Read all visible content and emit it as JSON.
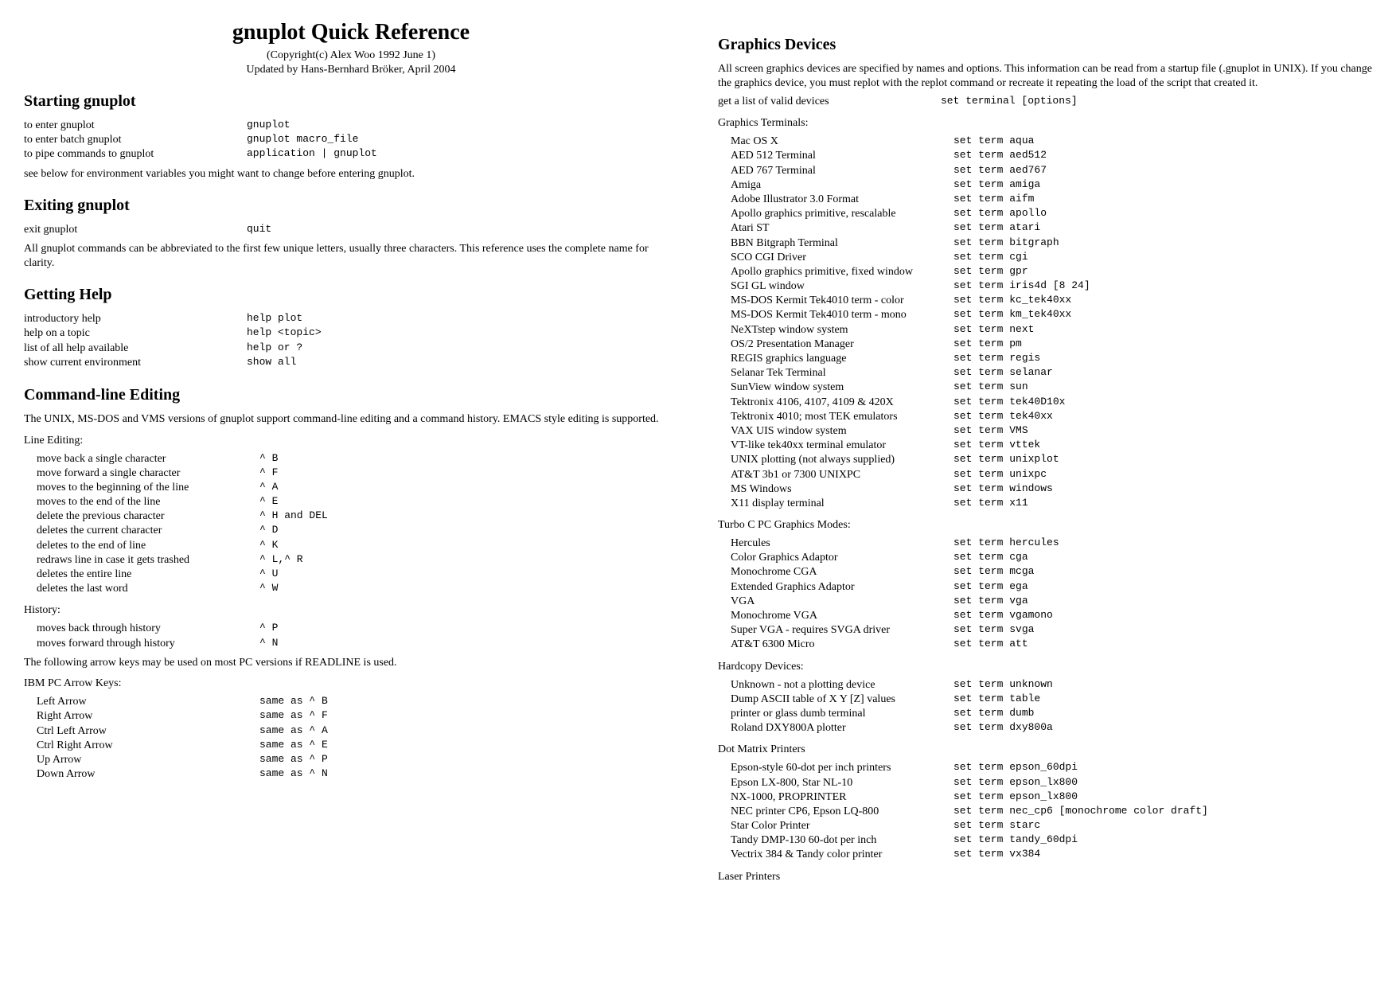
{
  "title": "gnuplot Quick Reference",
  "copyright": "(Copyright(c) Alex Woo 1992 June 1)",
  "updated": "Updated by Hans-Bernhard Bröker, April 2004",
  "sections": {
    "starting": {
      "heading": "Starting gnuplot",
      "rows": [
        {
          "label": "to enter gnuplot",
          "cmd": "gnuplot"
        },
        {
          "label": "to enter batch gnuplot",
          "cmd": "gnuplot macro_file"
        },
        {
          "label": "to pipe commands to gnuplot",
          "cmd": "application | gnuplot"
        }
      ],
      "note": "see below for environment variables you might want to change before entering gnuplot."
    },
    "exiting": {
      "heading": "Exiting gnuplot",
      "rows": [
        {
          "label": "exit gnuplot",
          "cmd": "quit"
        }
      ],
      "note": "All gnuplot commands can be abbreviated to the first few unique letters, usually three characters. This reference uses the complete name for clarity."
    },
    "help": {
      "heading": "Getting Help",
      "rows": [
        {
          "label": "introductory help",
          "cmd": "help plot"
        },
        {
          "label": "help on a topic",
          "cmd": "help <topic>"
        },
        {
          "label": "list of all help available",
          "cmd": "help or ?"
        },
        {
          "label": "show current environment",
          "cmd": "show all"
        }
      ]
    },
    "cmdline": {
      "heading": "Command-line Editing",
      "intro": "The UNIX, MS-DOS and VMS versions of gnuplot support command-line editing and a command history. EMACS style editing is supported.",
      "lineEditingLabel": "Line Editing:",
      "lineEditing": [
        {
          "label": "move back a single character",
          "cmd": "^ B"
        },
        {
          "label": "move forward a single character",
          "cmd": "^ F"
        },
        {
          "label": "moves to the beginning of the line",
          "cmd": "^ A"
        },
        {
          "label": "moves to the end of the line",
          "cmd": "^ E"
        },
        {
          "label": "delete the previous character",
          "cmd": "^ H and DEL"
        },
        {
          "label": "deletes the current character",
          "cmd": "^ D"
        },
        {
          "label": "deletes to the end of line",
          "cmd": "^ K"
        },
        {
          "label": "redraws line in case it gets trashed",
          "cmd": "^ L,^ R"
        },
        {
          "label": "deletes the entire line",
          "cmd": "^ U"
        },
        {
          "label": "deletes the last word",
          "cmd": "^ W"
        }
      ],
      "historyLabel": "History:",
      "history": [
        {
          "label": "moves back through history",
          "cmd": "^ P"
        },
        {
          "label": "moves forward through history",
          "cmd": "^ N"
        }
      ],
      "arrowNote": "The following arrow keys may be used on most PC versions if READLINE is used.",
      "arrowKeysLabel": "IBM PC Arrow Keys:",
      "arrowKeys": [
        {
          "label": "Left Arrow",
          "cmd": "same as ^ B"
        },
        {
          "label": "Right Arrow",
          "cmd": "same as ^ F"
        },
        {
          "label": "Ctrl Left Arrow",
          "cmd": "same as ^ A"
        },
        {
          "label": "Ctrl Right Arrow",
          "cmd": "same as ^ E"
        },
        {
          "label": "Up Arrow",
          "cmd": "same as ^ P"
        },
        {
          "label": "Down Arrow",
          "cmd": "same as ^ N"
        }
      ]
    },
    "graphics": {
      "heading": "Graphics Devices",
      "intro": "All screen graphics devices are specified by names and options. This information can be read from a startup file (.gnuplot in UNIX). If you change the graphics device, you must replot with the replot command or recreate it repeating the load of the script that created it.",
      "listRow": {
        "label": "get a list of valid devices",
        "cmd": "set terminal [options]"
      },
      "termLabel": "Graphics Terminals:",
      "terminals": [
        {
          "label": "Mac OS X",
          "cmd": "set term aqua"
        },
        {
          "label": "AED 512 Terminal",
          "cmd": "set term aed512"
        },
        {
          "label": "AED 767 Terminal",
          "cmd": "set term aed767"
        },
        {
          "label": "Amiga",
          "cmd": "set term amiga"
        },
        {
          "label": "Adobe Illustrator 3.0 Format",
          "cmd": "set term aifm"
        },
        {
          "label": "Apollo graphics primitive, rescalable",
          "cmd": "set term apollo"
        },
        {
          "label": "Atari ST",
          "cmd": "set term atari"
        },
        {
          "label": "BBN Bitgraph Terminal",
          "cmd": "set term bitgraph"
        },
        {
          "label": "SCO CGI Driver",
          "cmd": "set term cgi"
        },
        {
          "label": "Apollo graphics primitive, fixed window",
          "cmd": "set term gpr"
        },
        {
          "label": "SGI GL window",
          "cmd": "set term iris4d [8 24]"
        },
        {
          "label": "MS-DOS Kermit Tek4010 term - color",
          "cmd": "set term kc_tek40xx"
        },
        {
          "label": "MS-DOS Kermit Tek4010 term - mono",
          "cmd": "set term km_tek40xx"
        },
        {
          "label": "NeXTstep window system",
          "cmd": "set term next"
        },
        {
          "label": "OS/2 Presentation Manager",
          "cmd": "set term pm"
        },
        {
          "label": "REGIS graphics language",
          "cmd": "set term regis"
        },
        {
          "label": "Selanar Tek Terminal",
          "cmd": "set term selanar"
        },
        {
          "label": "SunView window system",
          "cmd": "set term sun"
        },
        {
          "label": "Tektronix 4106, 4107, 4109 & 420X",
          "cmd": "set term tek40D10x"
        },
        {
          "label": "Tektronix 4010; most TEK emulators",
          "cmd": "set term tek40xx"
        },
        {
          "label": "VAX UIS window system",
          "cmd": "set term VMS"
        },
        {
          "label": "VT-like tek40xx terminal emulator",
          "cmd": "set term vttek"
        },
        {
          "label": "UNIX plotting (not always supplied)",
          "cmd": "set term unixplot"
        },
        {
          "label": "AT&T 3b1 or 7300 UNIXPC",
          "cmd": "set term unixpc"
        },
        {
          "label": "MS Windows",
          "cmd": "set term windows"
        },
        {
          "label": "X11 display terminal",
          "cmd": "set term x11"
        }
      ],
      "turboLabel": "Turbo C PC Graphics Modes:",
      "turbo": [
        {
          "label": "Hercules",
          "cmd": "set term hercules"
        },
        {
          "label": "Color Graphics Adaptor",
          "cmd": "set term cga"
        },
        {
          "label": "Monochrome CGA",
          "cmd": "set term mcga"
        },
        {
          "label": "Extended Graphics Adaptor",
          "cmd": "set term ega"
        },
        {
          "label": "VGA",
          "cmd": "set term vga"
        },
        {
          "label": "Monochrome VGA",
          "cmd": "set term vgamono"
        },
        {
          "label": "Super VGA - requires SVGA driver",
          "cmd": "set term svga"
        },
        {
          "label": "AT&T 6300 Micro",
          "cmd": "set term att"
        }
      ],
      "hardcopyLabel": "Hardcopy Devices:",
      "hardcopy": [
        {
          "label": "Unknown - not a plotting device",
          "cmd": "set term unknown"
        },
        {
          "label": "Dump ASCII table of X Y [Z] values",
          "cmd": "set term table"
        },
        {
          "label": "printer or glass dumb terminal",
          "cmd": "set term dumb"
        },
        {
          "label": "Roland DXY800A plotter",
          "cmd": "set term dxy800a"
        }
      ],
      "dotmatrixLabel": "Dot Matrix Printers",
      "dotmatrix": [
        {
          "label": "Epson-style 60-dot per inch printers",
          "cmd": "set term epson_60dpi"
        },
        {
          "label": "Epson LX-800, Star NL-10",
          "cmd": "set term epson_lx800"
        },
        {
          "label": "NX-1000, PROPRINTER",
          "cmd": "set term epson_lx800"
        },
        {
          "label": "NEC printer CP6, Epson LQ-800",
          "cmd": "set term nec_cp6 [monochrome color draft]"
        },
        {
          "label": "Star Color Printer",
          "cmd": "set term starc"
        },
        {
          "label": "Tandy DMP-130 60-dot per inch",
          "cmd": "set term tandy_60dpi"
        },
        {
          "label": "Vectrix 384 & Tandy color printer",
          "cmd": "set term vx384"
        }
      ],
      "laserLabel": "Laser Printers"
    }
  }
}
